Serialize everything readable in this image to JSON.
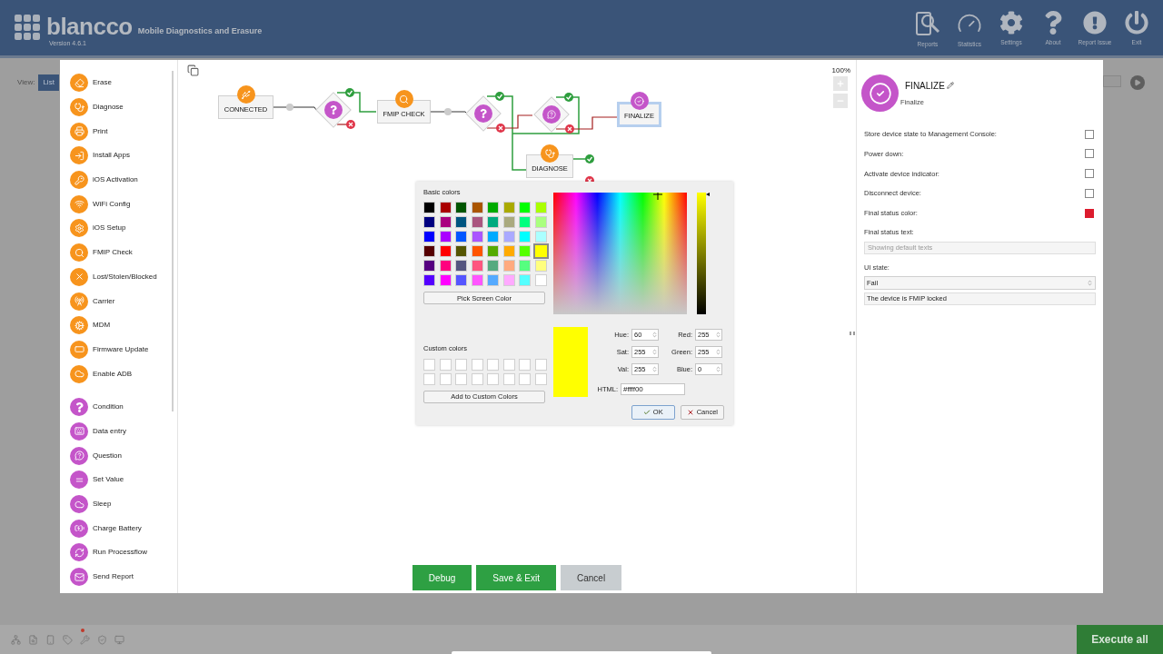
{
  "header": {
    "brand": "blancco",
    "subtitle": "Mobile Diagnostics and Erasure",
    "version": "Version 4.6.1",
    "nav": [
      {
        "label": "Reports"
      },
      {
        "label": "Statistics"
      },
      {
        "label": "Settings"
      },
      {
        "label": "About"
      },
      {
        "label": "Report Issue"
      },
      {
        "label": "Exit"
      }
    ]
  },
  "background": {
    "view_label": "View:",
    "view_button": "List"
  },
  "palette": {
    "sections": [
      {
        "color": "#f7941d",
        "items": [
          "Erase",
          "Diagnose",
          "Print",
          "Install Apps",
          "iOS Activation",
          "WiFi Config",
          "iOS Setup",
          "FMIP Check",
          "Lost/Stolen/Blocked",
          "Carrier",
          "MDM",
          "Firmware Update",
          "Enable ADB"
        ]
      },
      {
        "color": "#c455c9",
        "items": [
          "Condition",
          "Data entry",
          "Question",
          "Set Value",
          "Sleep",
          "Charge Battery",
          "Run Processflow",
          "Send Report"
        ]
      }
    ]
  },
  "canvas": {
    "zoom": "100%",
    "nodes": [
      {
        "kind": "task",
        "label": "CONNECTED",
        "selected": false
      },
      {
        "kind": "decision",
        "selected": false
      },
      {
        "kind": "task",
        "label": "FMIP CHECK",
        "selected": false
      },
      {
        "kind": "decision",
        "selected": false
      },
      {
        "kind": "question",
        "selected": false
      },
      {
        "kind": "finalize",
        "label": "FINALIZE",
        "selected": true
      },
      {
        "kind": "task",
        "label": "DIAGNOSE",
        "selected": false
      }
    ],
    "buttons": [
      {
        "kind": "primary",
        "label": "Debug"
      },
      {
        "kind": "primary",
        "label": "Save & Exit"
      },
      {
        "kind": "secondary",
        "label": "Cancel"
      }
    ]
  },
  "color_dialog": {
    "basic_label": "Basic colors",
    "swatches": [
      {
        "color": "#000000",
        "selected": false
      },
      {
        "color": "#aa0000",
        "selected": false
      },
      {
        "color": "#005500",
        "selected": false
      },
      {
        "color": "#aa5500",
        "selected": false
      },
      {
        "color": "#00aa00",
        "selected": false
      },
      {
        "color": "#aaaa00",
        "selected": false
      },
      {
        "color": "#00ff00",
        "selected": false
      },
      {
        "color": "#aaff00",
        "selected": false
      },
      {
        "color": "#000080",
        "selected": false
      },
      {
        "color": "#aa007f",
        "selected": false
      },
      {
        "color": "#005580",
        "selected": false
      },
      {
        "color": "#aa557f",
        "selected": false
      },
      {
        "color": "#00aa7f",
        "selected": false
      },
      {
        "color": "#aaaa7f",
        "selected": false
      },
      {
        "color": "#00ff7f",
        "selected": false
      },
      {
        "color": "#aaff7f",
        "selected": false
      },
      {
        "color": "#0000ff",
        "selected": false
      },
      {
        "color": "#aa00ff",
        "selected": false
      },
      {
        "color": "#0055ff",
        "selected": false
      },
      {
        "color": "#aa55ff",
        "selected": false
      },
      {
        "color": "#00aaff",
        "selected": false
      },
      {
        "color": "#aaaaff",
        "selected": false
      },
      {
        "color": "#00ffff",
        "selected": false
      },
      {
        "color": "#aaffff",
        "selected": false
      },
      {
        "color": "#550000",
        "selected": false
      },
      {
        "color": "#ff0000",
        "selected": false
      },
      {
        "color": "#555500",
        "selected": false
      },
      {
        "color": "#ff5500",
        "selected": false
      },
      {
        "color": "#55aa00",
        "selected": false
      },
      {
        "color": "#ffaa00",
        "selected": false
      },
      {
        "color": "#55ff00",
        "selected": false
      },
      {
        "color": "#ffff00",
        "selected": true
      },
      {
        "color": "#550080",
        "selected": false
      },
      {
        "color": "#ff007f",
        "selected": false
      },
      {
        "color": "#55557f",
        "selected": false
      },
      {
        "color": "#ff557f",
        "selected": false
      },
      {
        "color": "#55aa7f",
        "selected": false
      },
      {
        "color": "#ffaa7f",
        "selected": false
      },
      {
        "color": "#55ff7f",
        "selected": false
      },
      {
        "color": "#ffff7f",
        "selected": false
      },
      {
        "color": "#5500ff",
        "selected": false
      },
      {
        "color": "#ff00ff",
        "selected": false
      },
      {
        "color": "#5555ff",
        "selected": false
      },
      {
        "color": "#ff55ff",
        "selected": false
      },
      {
        "color": "#55aaff",
        "selected": false
      },
      {
        "color": "#ffaaff",
        "selected": false
      },
      {
        "color": "#55ffff",
        "selected": false
      },
      {
        "color": "#ffffff",
        "selected": false
      }
    ],
    "pick_button": "Pick Screen Color",
    "custom_label": "Custom colors",
    "add_button": "Add to Custom Colors",
    "preview_color": "#ffff00",
    "value_slider": {
      "level": 1
    },
    "fields": [
      {
        "label": "Hue:",
        "value": "60"
      },
      {
        "label": "Red:",
        "value": "255"
      },
      {
        "label": "Sat:",
        "value": "255"
      },
      {
        "label": "Green:",
        "value": "255"
      },
      {
        "label": "Val:",
        "value": "255"
      },
      {
        "label": "Blue:",
        "value": "0"
      }
    ],
    "html_label": "HTML:",
    "ok": "OK",
    "cancel": "Cancel"
  },
  "properties": {
    "title": "FINALIZE",
    "subtitle": "Finalize",
    "options": [
      {
        "kind": "checkbox",
        "label": "Store device state to Management Console:",
        "checked": false
      },
      {
        "kind": "checkbox",
        "label": "Power down:",
        "checked": false
      },
      {
        "kind": "checkbox",
        "label": "Activate device indicator:",
        "checked": false
      },
      {
        "kind": "checkbox",
        "label": "Disconnect device:",
        "checked": false
      },
      {
        "kind": "color",
        "label": "Final status color:",
        "color": "#dc1c2e"
      }
    ],
    "status_text_label": "Final status text:",
    "status_text_value": "Showing default texts",
    "ui_state_label": "UI state:",
    "ui_state_value": "Fail",
    "message_value": "The device is FMIP locked"
  },
  "bottom_bar": {
    "execute_button": "Execute all"
  }
}
